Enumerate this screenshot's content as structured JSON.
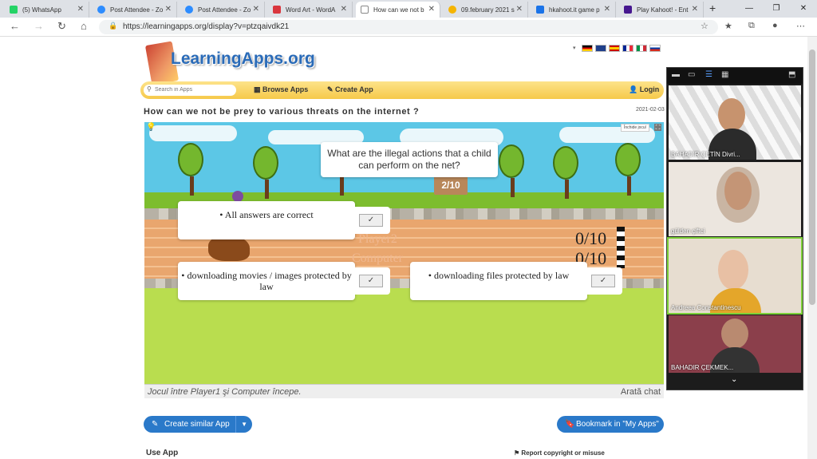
{
  "browser": {
    "tabs": [
      {
        "label": "(5) WhatsApp",
        "color": "#25d366"
      },
      {
        "label": "Post Attendee - Zo",
        "color": "#2d8cff"
      },
      {
        "label": "Post Attendee - Zo",
        "color": "#2d8cff"
      },
      {
        "label": "Word Art - WordA",
        "color": "#d9363e"
      },
      {
        "label": "How can we not b",
        "color": "#8a8a8a"
      },
      {
        "label": "09.february 2021 s",
        "color": "#f5b400"
      },
      {
        "label": "hkahoot.it game p",
        "color": "#1a73e8"
      },
      {
        "label": "Play Kahoot! - Ent",
        "color": "#46178f"
      }
    ],
    "url": "https://learningapps.org/display?v=ptzqaivdk21"
  },
  "site": {
    "logo": "LearningApps.org",
    "search_placeholder": "Search in Apps",
    "menu": {
      "browse": "Browse Apps",
      "create": "Create App",
      "login": "Login"
    }
  },
  "app": {
    "title": "How can we not be prey to various threats on the internet ?",
    "date": "2021-02-03",
    "close_game": "Închide jocul",
    "question": "What are the illegal actions that a child can perform on the net?",
    "counter": "2/10",
    "player2": "Player2",
    "computer": "Computer",
    "score1": "0/10",
    "score2": "0/10",
    "answers": [
      "• All answers are correct",
      "• downloading movies / images protected by law",
      "• downloading files protected by law"
    ],
    "check_symbol": "✓",
    "status": "Jocul între Player1 şi Computer începe.",
    "show_chat": "Arată chat"
  },
  "footer": {
    "create_similar": "Create similar App",
    "bookmark": "Bookmark in \"My Apps\"",
    "use_app": "Use App",
    "report": "Report copyright or misuse"
  },
  "zoom": {
    "participants": [
      "BAHADIR ÇETİN Divri...",
      "gülden çiftci",
      "Andreea Constantinescu",
      "BAHADIR ÇEKMEK..."
    ]
  },
  "icons": [
    "back-icon",
    "forward-icon",
    "reload-icon",
    "home-icon",
    "lock-icon",
    "search-icon",
    "grid-icon",
    "pencil-icon",
    "user-icon",
    "edit-icon",
    "bookmark-icon",
    "flag-icon",
    "lightbulb-icon",
    "fullscreen-icon",
    "chevron-down-icon"
  ]
}
